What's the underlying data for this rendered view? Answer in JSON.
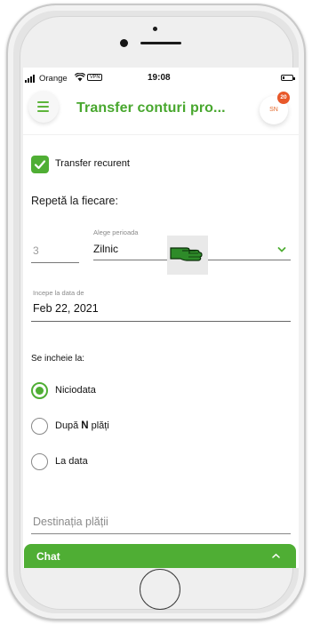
{
  "status_bar": {
    "carrier": "Orange",
    "vpn": "VPN",
    "time": "19:08",
    "battery_level": 0.2
  },
  "header": {
    "title": "Transfer conturi pro...",
    "avatar_initials": "SN",
    "notification_count": "20"
  },
  "form": {
    "recurring_checkbox": {
      "label": "Transfer recurent",
      "checked": true
    },
    "repeat_label": "Repetă la fiecare:",
    "interval_count": "3",
    "period": {
      "label": "Alege perioada",
      "value": "Zilnic"
    },
    "start_date": {
      "label": "Incepe la data de",
      "value": "Feb 22, 2021"
    },
    "ends_label": "Se incheie la:",
    "end_options": [
      {
        "label": "Niciodata",
        "selected": true
      },
      {
        "prefix": "După",
        "value": "N",
        "suffix": "plăți",
        "selected": false
      },
      {
        "label": "La data",
        "selected": false
      }
    ],
    "destination_placeholder": "Destinația plății"
  },
  "chat": {
    "label": "Chat"
  },
  "colors": {
    "accent": "#4fae34",
    "title": "#48a72e",
    "badge": "#e8582a"
  },
  "icons": [
    "menu-icon",
    "check-icon",
    "chevron-down-icon",
    "hand-pointer-icon",
    "chevron-up-icon",
    "wifi-icon",
    "signal-icon",
    "battery-icon"
  ]
}
